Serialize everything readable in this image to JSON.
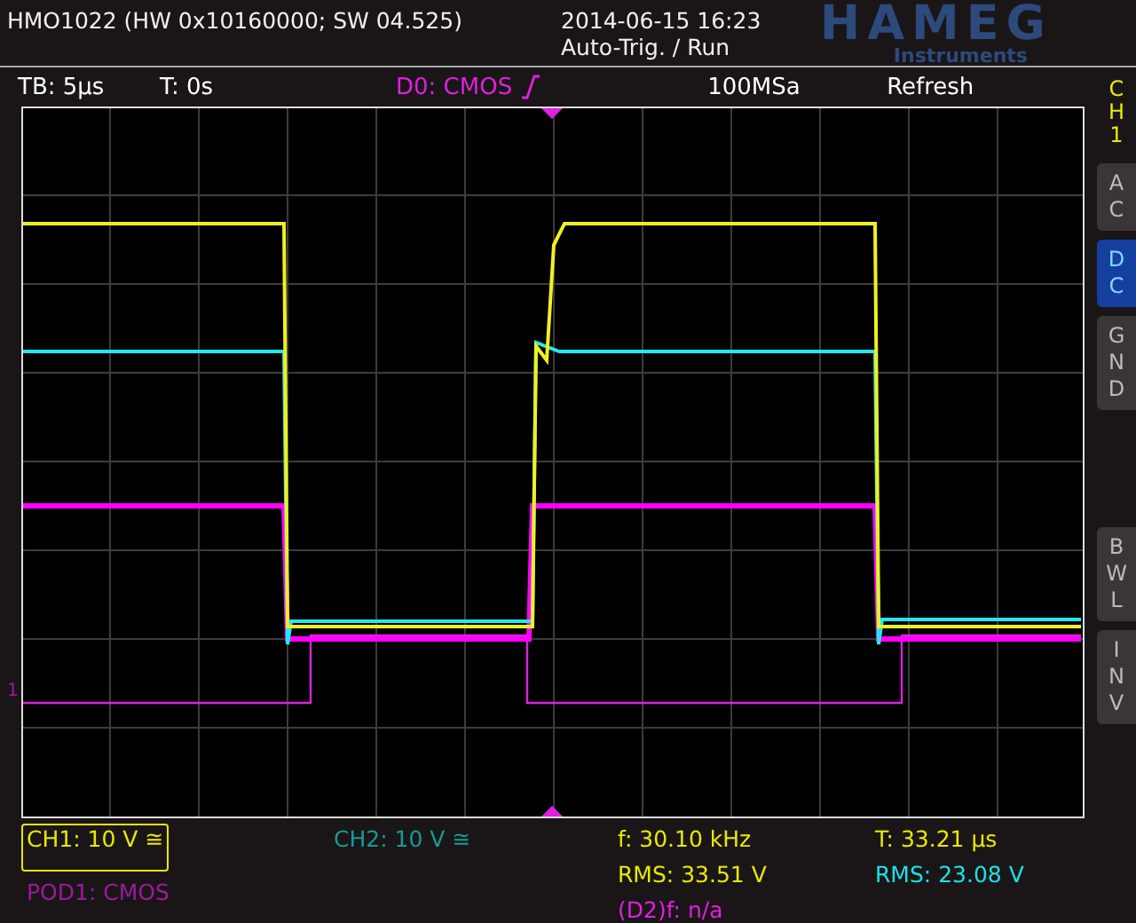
{
  "header": {
    "device": "HMO1022 (HW 0x10160000; SW 04.525)",
    "datetime": "2014-06-15 16:23",
    "run_state": "Auto-Trig. / Run",
    "logo": "HAMEG",
    "logo_sub": "Instruments"
  },
  "info_bar": {
    "timebase": "TB: 5µs",
    "trigger_time": "T: 0s",
    "trigger_source": "D0: CMOS",
    "sample_rate": "100MSa",
    "acquire_mode": "Refresh"
  },
  "side_panel": {
    "channel": "CH1",
    "coupling_buttons": [
      {
        "label": "AC",
        "selected": false
      },
      {
        "label": "DC",
        "selected": true
      },
      {
        "label": "GND",
        "selected": false
      }
    ],
    "option_buttons": [
      {
        "label": "BWL",
        "selected": false
      },
      {
        "label": "INV",
        "selected": false
      }
    ]
  },
  "plot": {
    "ground_marker": "1"
  },
  "channel_readouts": [
    {
      "text": "CH1: 10 V ≅",
      "color": "#e8e800",
      "selected": true
    },
    {
      "text": "CH2: 10 V ≅",
      "color": "#169a9a",
      "selected": false
    },
    {
      "text": "POD1: CMOS",
      "color": "#a0179f",
      "selected": false
    }
  ],
  "measurements": [
    {
      "text": "f: 30.10 kHz",
      "color": "#e8e800"
    },
    {
      "text": "T: 33.21 µs",
      "color": "#e8e800"
    },
    {
      "text": "RMS: 33.51 V",
      "color": "#e8e800"
    },
    {
      "text": "RMS: 23.08 V",
      "color": "#1ee0e8"
    },
    {
      "text": "(D2)f: n/a",
      "color": "#e020e0"
    }
  ]
}
